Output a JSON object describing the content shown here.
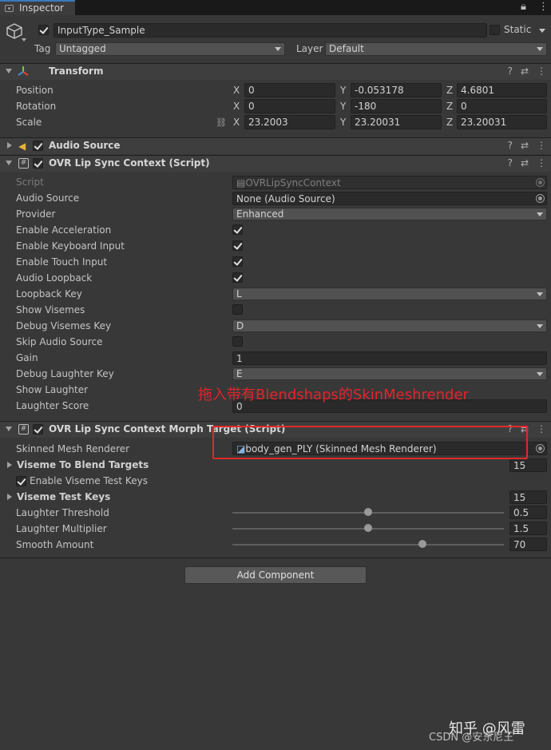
{
  "tab": {
    "title": "Inspector",
    "lock_icon": "lock-icon",
    "menu_icon": "kebab-menu-icon"
  },
  "object": {
    "name": "InputType_Sample",
    "static_label": "Static",
    "tag_label": "Tag",
    "tag_value": "Untagged",
    "layer_label": "Layer",
    "layer_value": "Default"
  },
  "transform": {
    "title": "Transform",
    "rows": [
      {
        "label": "Position",
        "x": "0",
        "y": "-0.053178",
        "z": "4.6801"
      },
      {
        "label": "Rotation",
        "x": "0",
        "y": "-180",
        "z": "0"
      },
      {
        "label": "Scale",
        "x": "23.2003",
        "y": "23.20031",
        "z": "23.20031"
      }
    ],
    "axes": {
      "x": "X",
      "y": "Y",
      "z": "Z"
    }
  },
  "audio_source": {
    "title": "Audio Source"
  },
  "lipsync": {
    "title": "OVR Lip Sync Context (Script)",
    "script_label": "Script",
    "script_value": "OVRLipSyncContext",
    "audio_source_label": "Audio Source",
    "audio_source_value": "None (Audio Source)",
    "provider_label": "Provider",
    "provider_value": "Enhanced",
    "enable_acceleration_label": "Enable Acceleration",
    "enable_keyboard_label": "Enable Keyboard Input",
    "enable_touch_label": "Enable Touch Input",
    "audio_loopback_label": "Audio Loopback",
    "loopback_key_label": "Loopback Key",
    "loopback_key_value": "L",
    "show_visemes_label": "Show Visemes",
    "debug_visemes_key_label": "Debug Visemes Key",
    "debug_visemes_key_value": "D",
    "skip_audio_label": "Skip Audio Source",
    "gain_label": "Gain",
    "gain_value": "1",
    "debug_laughter_key_label": "Debug Laughter Key",
    "debug_laughter_key_value": "E",
    "show_laughter_label": "Show Laughter",
    "laughter_score_label": "Laughter Score",
    "laughter_score_value": "0"
  },
  "morph": {
    "title": "OVR Lip Sync Context Morph Target (Script)",
    "smr_label": "Skinned Mesh Renderer",
    "smr_value": "body_gen_PLY (Skinned Mesh Renderer)",
    "viseme_blend_label": "Viseme To Blend Targets",
    "viseme_blend_value": "15",
    "enable_viseme_test_label": "Enable Viseme Test Keys",
    "viseme_test_keys_label": "Viseme Test Keys",
    "viseme_test_keys_value": "15",
    "laughter_threshold_label": "Laughter Threshold",
    "laughter_threshold_value": "0.5",
    "laughter_threshold_frac": 0.5,
    "laughter_multiplier_label": "Laughter Multiplier",
    "laughter_multiplier_value": "1.5",
    "laughter_multiplier_frac": 0.5,
    "smooth_amount_label": "Smooth Amount",
    "smooth_amount_value": "70",
    "smooth_amount_frac": 0.7
  },
  "add_component_label": "Add Component",
  "annotation_text": "拖入带有Blendshaps的SkinMeshrender",
  "watermark": {
    "zhihu": "知乎 @风雷",
    "csdn": "CSDN @安东尼王"
  },
  "colors": {
    "accent": "#3a79bb",
    "annotation": "#e3232b",
    "background": "#383838"
  }
}
